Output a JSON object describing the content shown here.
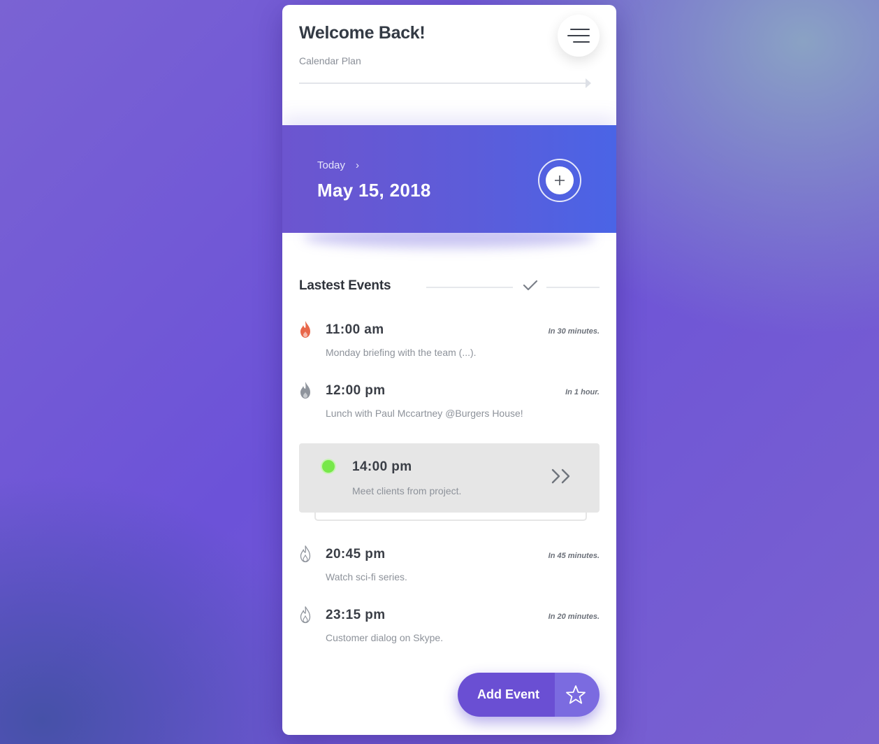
{
  "header": {
    "title": "Welcome Back!",
    "subtitle": "Calendar Plan"
  },
  "menu": {
    "icon": "hamburger-menu-icon"
  },
  "today_panel": {
    "label": "Today",
    "chevron": "›",
    "date": "May 15, 2018",
    "add_icon": "plus-icon"
  },
  "events_section": {
    "title": "Lastest Events",
    "check_icon": "checkmark-icon"
  },
  "events": [
    {
      "time": "11:00 am",
      "eta": "In 30 minutes.",
      "description": "Monday briefing with the team (...).",
      "icon": "flame-icon",
      "icon_color": "#e8674a",
      "icon_style": "filled"
    },
    {
      "time": "12:00 pm",
      "eta": "In 1 hour.",
      "description": "Lunch with Paul Mccartney @Burgers House!",
      "icon": "flame-icon",
      "icon_color": "#8f949c",
      "icon_style": "filled"
    },
    {
      "time": "20:45 pm",
      "eta": "In 45 minutes.",
      "description": "Watch sci-fi series.",
      "icon": "flame-icon",
      "icon_color": "#8f949c",
      "icon_style": "outline"
    },
    {
      "time": "23:15 pm",
      "eta": "In 20 minutes.",
      "description": "Customer dialog on Skype.",
      "icon": "flame-icon",
      "icon_color": "#8f949c",
      "icon_style": "outline"
    }
  ],
  "active_event": {
    "time": "14:00 pm",
    "description": "Meet clients from project.",
    "status_color": "#77e84a",
    "action_icon": "double-chevron-right-icon"
  },
  "fab": {
    "label": "Add Event",
    "star_icon": "star-icon"
  },
  "colors": {
    "accent": "#6a4fd3",
    "hero_start": "#6c55cf",
    "hero_end": "#4a64e6"
  }
}
